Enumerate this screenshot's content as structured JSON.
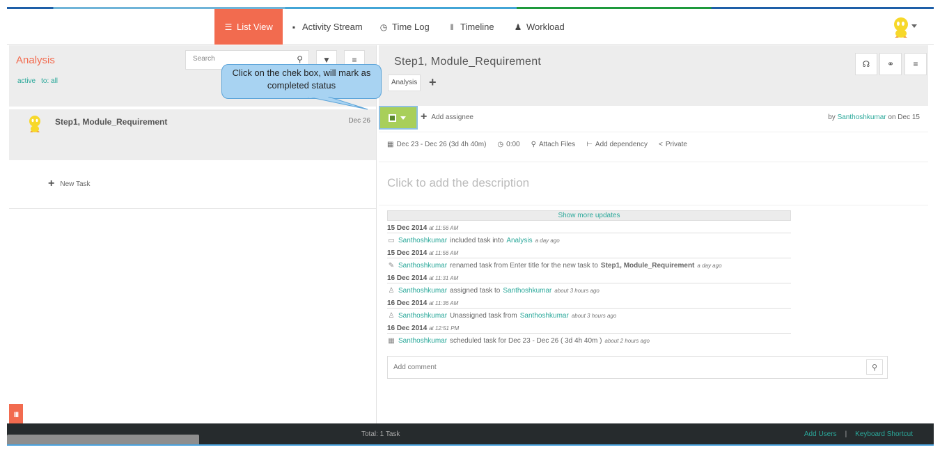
{
  "nav": {
    "items": [
      {
        "label": "List View",
        "icon": "list-icon"
      },
      {
        "label": "Activity Stream",
        "icon": "comment-icon"
      },
      {
        "label": "Time Log",
        "icon": "clock-icon"
      },
      {
        "label": "Timeline",
        "icon": "timeline-icon"
      },
      {
        "label": "Workload",
        "icon": "user-icon"
      }
    ],
    "active_index": 0
  },
  "left": {
    "project_title": "Analysis",
    "filter_status": "active",
    "filter_to": "to: all",
    "search_placeholder": "Search",
    "task": {
      "name": "Step1, Module_Requirement",
      "date": "Dec 26"
    },
    "new_task_label": "New Task",
    "bottom_tab": "III"
  },
  "detail": {
    "title": "Step1, Module_Requirement",
    "tag": "Analysis",
    "add_assignee": "Add assignee",
    "by_prefix": "by",
    "by_user": "Santhoshkumar",
    "by_suffix": "on Dec 15",
    "meta": {
      "dates": "Dec 23 - Dec 26 (3d 4h 40m)",
      "time": "0:00",
      "attach": "Attach Files",
      "dependency": "Add dependency",
      "private": "Private"
    },
    "description_placeholder": "Click to add the description",
    "show_more": "Show more updates",
    "updates": [
      {
        "date": "15 Dec 2014",
        "time": "at 11:56 AM",
        "icon": "folder-icon",
        "user": "Santhoshkumar",
        "text": "included task into",
        "link": "Analysis",
        "bold": "",
        "ago": "a day ago"
      },
      {
        "date": "15 Dec 2014",
        "time": "at 11:56 AM",
        "icon": "pencil-icon",
        "user": "Santhoshkumar",
        "text": "renamed task from Enter title for the new task to",
        "link": "",
        "bold": "Step1, Module_Requirement",
        "ago": "a day ago"
      },
      {
        "date": "16 Dec 2014",
        "time": "at 11:31 AM",
        "icon": "assign-icon",
        "user": "Santhoshkumar",
        "text": "assigned task to",
        "link": "Santhoshkumar",
        "bold": "",
        "ago": "about 3 hours ago"
      },
      {
        "date": "16 Dec 2014",
        "time": "at 11:36 AM",
        "icon": "assign-icon",
        "user": "Santhoshkumar",
        "text": "Unassigned task from",
        "link": "Santhoshkumar",
        "bold": "",
        "ago": "about 3 hours ago"
      },
      {
        "date": "16 Dec 2014",
        "time": "at 12:51 PM",
        "icon": "calendar-icon",
        "user": "Santhoshkumar",
        "text": "scheduled task for Dec 23 - Dec 26 ( 3d 4h 40m )",
        "link": "",
        "bold": "",
        "ago": "about 2 hours ago"
      }
    ],
    "comment_placeholder": "Add comment"
  },
  "footer": {
    "total": "Total: 1 Task",
    "add_users": "Add Users",
    "separator": "|",
    "keyboard": "Keyboard Shortcut"
  },
  "callout": {
    "text": "Click on the chek box, will mark as completed status"
  },
  "colors": {
    "accent": "#f26b4f",
    "teal": "#2aa89a",
    "checkbox_green": "#a8cf5a",
    "callout_blue": "#a8d3f2",
    "footer_bg": "#262b2d"
  }
}
